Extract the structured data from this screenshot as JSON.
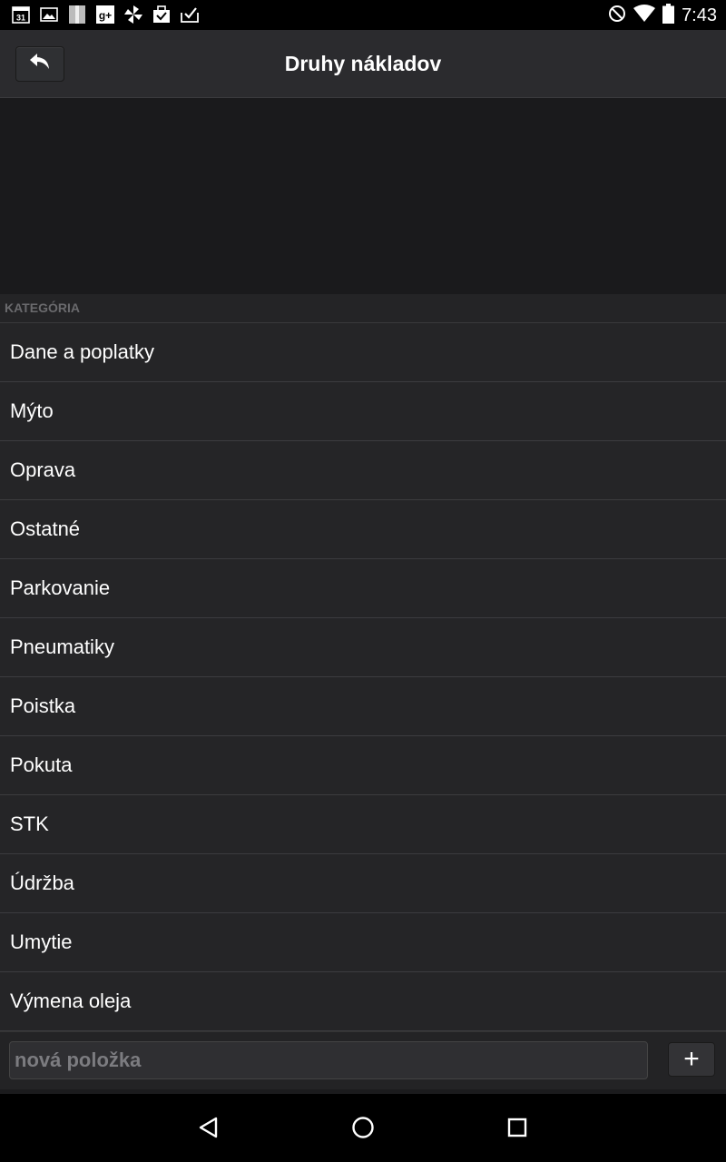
{
  "status_bar": {
    "time": "7:43",
    "left_icons": [
      "calendar-icon",
      "gallery-icon",
      "notes-icon",
      "google-plus-icon",
      "pinwheel-icon",
      "bag-check-icon",
      "tray-check-icon"
    ],
    "right_icons": [
      "do-not-disturb-icon",
      "wifi-icon",
      "battery-icon"
    ],
    "calendar_day": "31"
  },
  "action_bar": {
    "title": "Druhy nákladov",
    "back_icon": "reply-arrow-icon"
  },
  "list": {
    "section_header": "KATEGÓRIA",
    "items": [
      "Dane a poplatky",
      "Mýto",
      "Oprava",
      "Ostatné",
      "Parkovanie",
      "Pneumatiky",
      "Poistka",
      "Pokuta",
      "STK",
      "Údržba",
      "Umytie",
      "Výmena oleja"
    ]
  },
  "input_bar": {
    "placeholder": "nová položka",
    "value": "",
    "add_label": "+"
  },
  "colors": {
    "background": "#1b1b1d",
    "action_bar": "#2b2b2e",
    "row_background": "#252527",
    "divider": "#3c3c3f",
    "text": "#ffffff",
    "section_text": "#6a6a6d"
  },
  "nav_bar": {
    "icons": [
      "back-triangle-icon",
      "home-circle-icon",
      "recents-square-icon"
    ]
  }
}
